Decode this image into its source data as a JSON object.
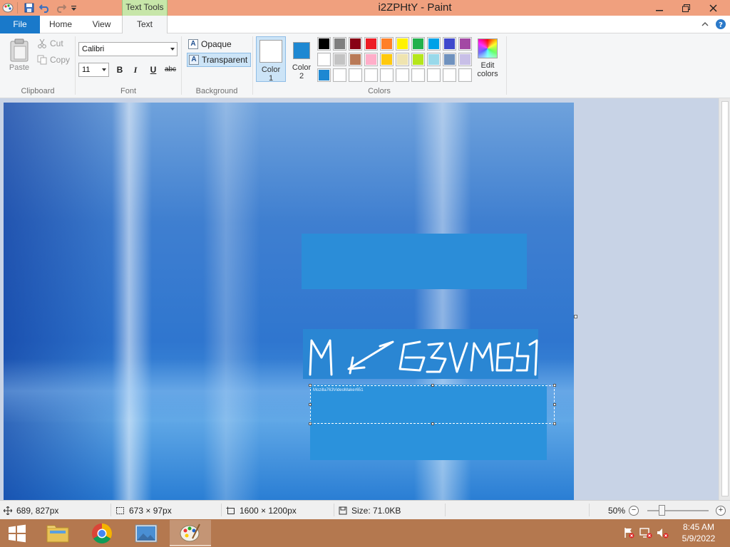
{
  "window": {
    "title": "i2ZPHtY - Paint",
    "context_tab": "Text Tools"
  },
  "tabs": {
    "file": "File",
    "home": "Home",
    "view": "View",
    "text": "Text"
  },
  "clipboard": {
    "paste": "Paste",
    "cut": "Cut",
    "copy": "Copy",
    "group_label": "Clipboard"
  },
  "font": {
    "family": "Calibri",
    "size": "11",
    "bold": "B",
    "italic": "I",
    "underline": "U",
    "strikethrough": "abc",
    "group_label": "Font"
  },
  "background": {
    "opaque": "Opaque",
    "transparent": "Transparent",
    "selected": "transparent",
    "group_label": "Background"
  },
  "colors": {
    "color1_label_line1": "Color",
    "color1_label_line2": "1",
    "color2_label_line1": "Color",
    "color2_label_line2": "2",
    "color1_value": "#ffffff",
    "color2_value": "#1e88d2",
    "edit_line1": "Edit",
    "edit_line2": "colors",
    "group_label": "Colors",
    "palette_row1": [
      "#000000",
      "#7f7f7f",
      "#880015",
      "#ed1c24",
      "#ff7f27",
      "#fff200",
      "#22b14c",
      "#00a2e8",
      "#3f48cc",
      "#a349a4"
    ],
    "palette_row2": [
      "#ffffff",
      "#c3c3c3",
      "#b97a57",
      "#ffaec9",
      "#ffc90e",
      "#efe4b0",
      "#b5e61d",
      "#99d9ea",
      "#7092be",
      "#c8bfe7"
    ],
    "palette_row3": [
      "#1e88d2",
      "#ffffff",
      "#ffffff",
      "#ffffff",
      "#ffffff",
      "#ffffff",
      "#ffffff",
      "#ffffff",
      "#ffffff",
      "#ffffff"
    ]
  },
  "canvas": {
    "handwritten_text": "MIZ63VM651",
    "textbox_content": "Mozilla763VideoMaker651"
  },
  "status": {
    "cursor_pos": "689, 827px",
    "selection_size": "673 × 97px",
    "image_size": "1600 × 1200px",
    "file_size": "Size: 71.0KB",
    "zoom": "50%",
    "zoom_out": "−",
    "zoom_in": "+"
  },
  "taskbar": {
    "time": "8:45 AM",
    "date": "5/9/2022"
  }
}
